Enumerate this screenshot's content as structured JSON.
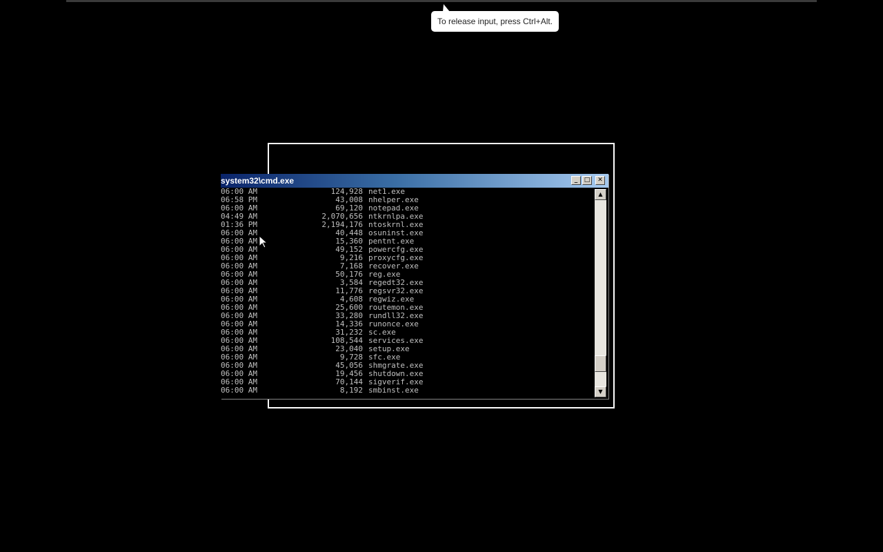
{
  "tooltip": {
    "text": "To release input, press Ctrl+Alt."
  },
  "window": {
    "title": "system32\\cmd.exe",
    "minimize_glyph": "_",
    "maximize_glyph": "□",
    "close_glyph": "✕"
  },
  "scrollbar": {
    "up_glyph": "▲",
    "down_glyph": "▼"
  },
  "rows": [
    {
      "time": "06:00 AM",
      "size": "124,928",
      "name": "net1.exe"
    },
    {
      "time": "06:58 PM",
      "size": "43,008",
      "name": "nhelper.exe"
    },
    {
      "time": "06:00 AM",
      "size": "69,120",
      "name": "notepad.exe"
    },
    {
      "time": "04:49 AM",
      "size": "2,070,656",
      "name": "ntkrnlpa.exe"
    },
    {
      "time": "01:36 PM",
      "size": "2,194,176",
      "name": "ntoskrnl.exe"
    },
    {
      "time": "06:00 AM",
      "size": "40,448",
      "name": "osuninst.exe"
    },
    {
      "time": "06:00 AM",
      "size": "15,360",
      "name": "pentnt.exe"
    },
    {
      "time": "06:00 AM",
      "size": "49,152",
      "name": "powercfg.exe"
    },
    {
      "time": "06:00 AM",
      "size": "9,216",
      "name": "proxycfg.exe"
    },
    {
      "time": "06:00 AM",
      "size": "7,168",
      "name": "recover.exe"
    },
    {
      "time": "06:00 AM",
      "size": "50,176",
      "name": "reg.exe"
    },
    {
      "time": "06:00 AM",
      "size": "3,584",
      "name": "regedt32.exe"
    },
    {
      "time": "06:00 AM",
      "size": "11,776",
      "name": "regsvr32.exe"
    },
    {
      "time": "06:00 AM",
      "size": "4,608",
      "name": "regwiz.exe"
    },
    {
      "time": "06:00 AM",
      "size": "25,600",
      "name": "routemon.exe"
    },
    {
      "time": "06:00 AM",
      "size": "33,280",
      "name": "rundll32.exe"
    },
    {
      "time": "06:00 AM",
      "size": "14,336",
      "name": "runonce.exe"
    },
    {
      "time": "06:00 AM",
      "size": "31,232",
      "name": "sc.exe"
    },
    {
      "time": "06:00 AM",
      "size": "108,544",
      "name": "services.exe"
    },
    {
      "time": "06:00 AM",
      "size": "23,040",
      "name": "setup.exe"
    },
    {
      "time": "06:00 AM",
      "size": "9,728",
      "name": "sfc.exe"
    },
    {
      "time": "06:00 AM",
      "size": "45,056",
      "name": "shmgrate.exe"
    },
    {
      "time": "06:00 AM",
      "size": "19,456",
      "name": "shutdown.exe"
    },
    {
      "time": "06:00 AM",
      "size": "70,144",
      "name": "sigverif.exe"
    },
    {
      "time": "06:00 AM",
      "size": "8,192",
      "name": "smbinst.exe"
    }
  ]
}
